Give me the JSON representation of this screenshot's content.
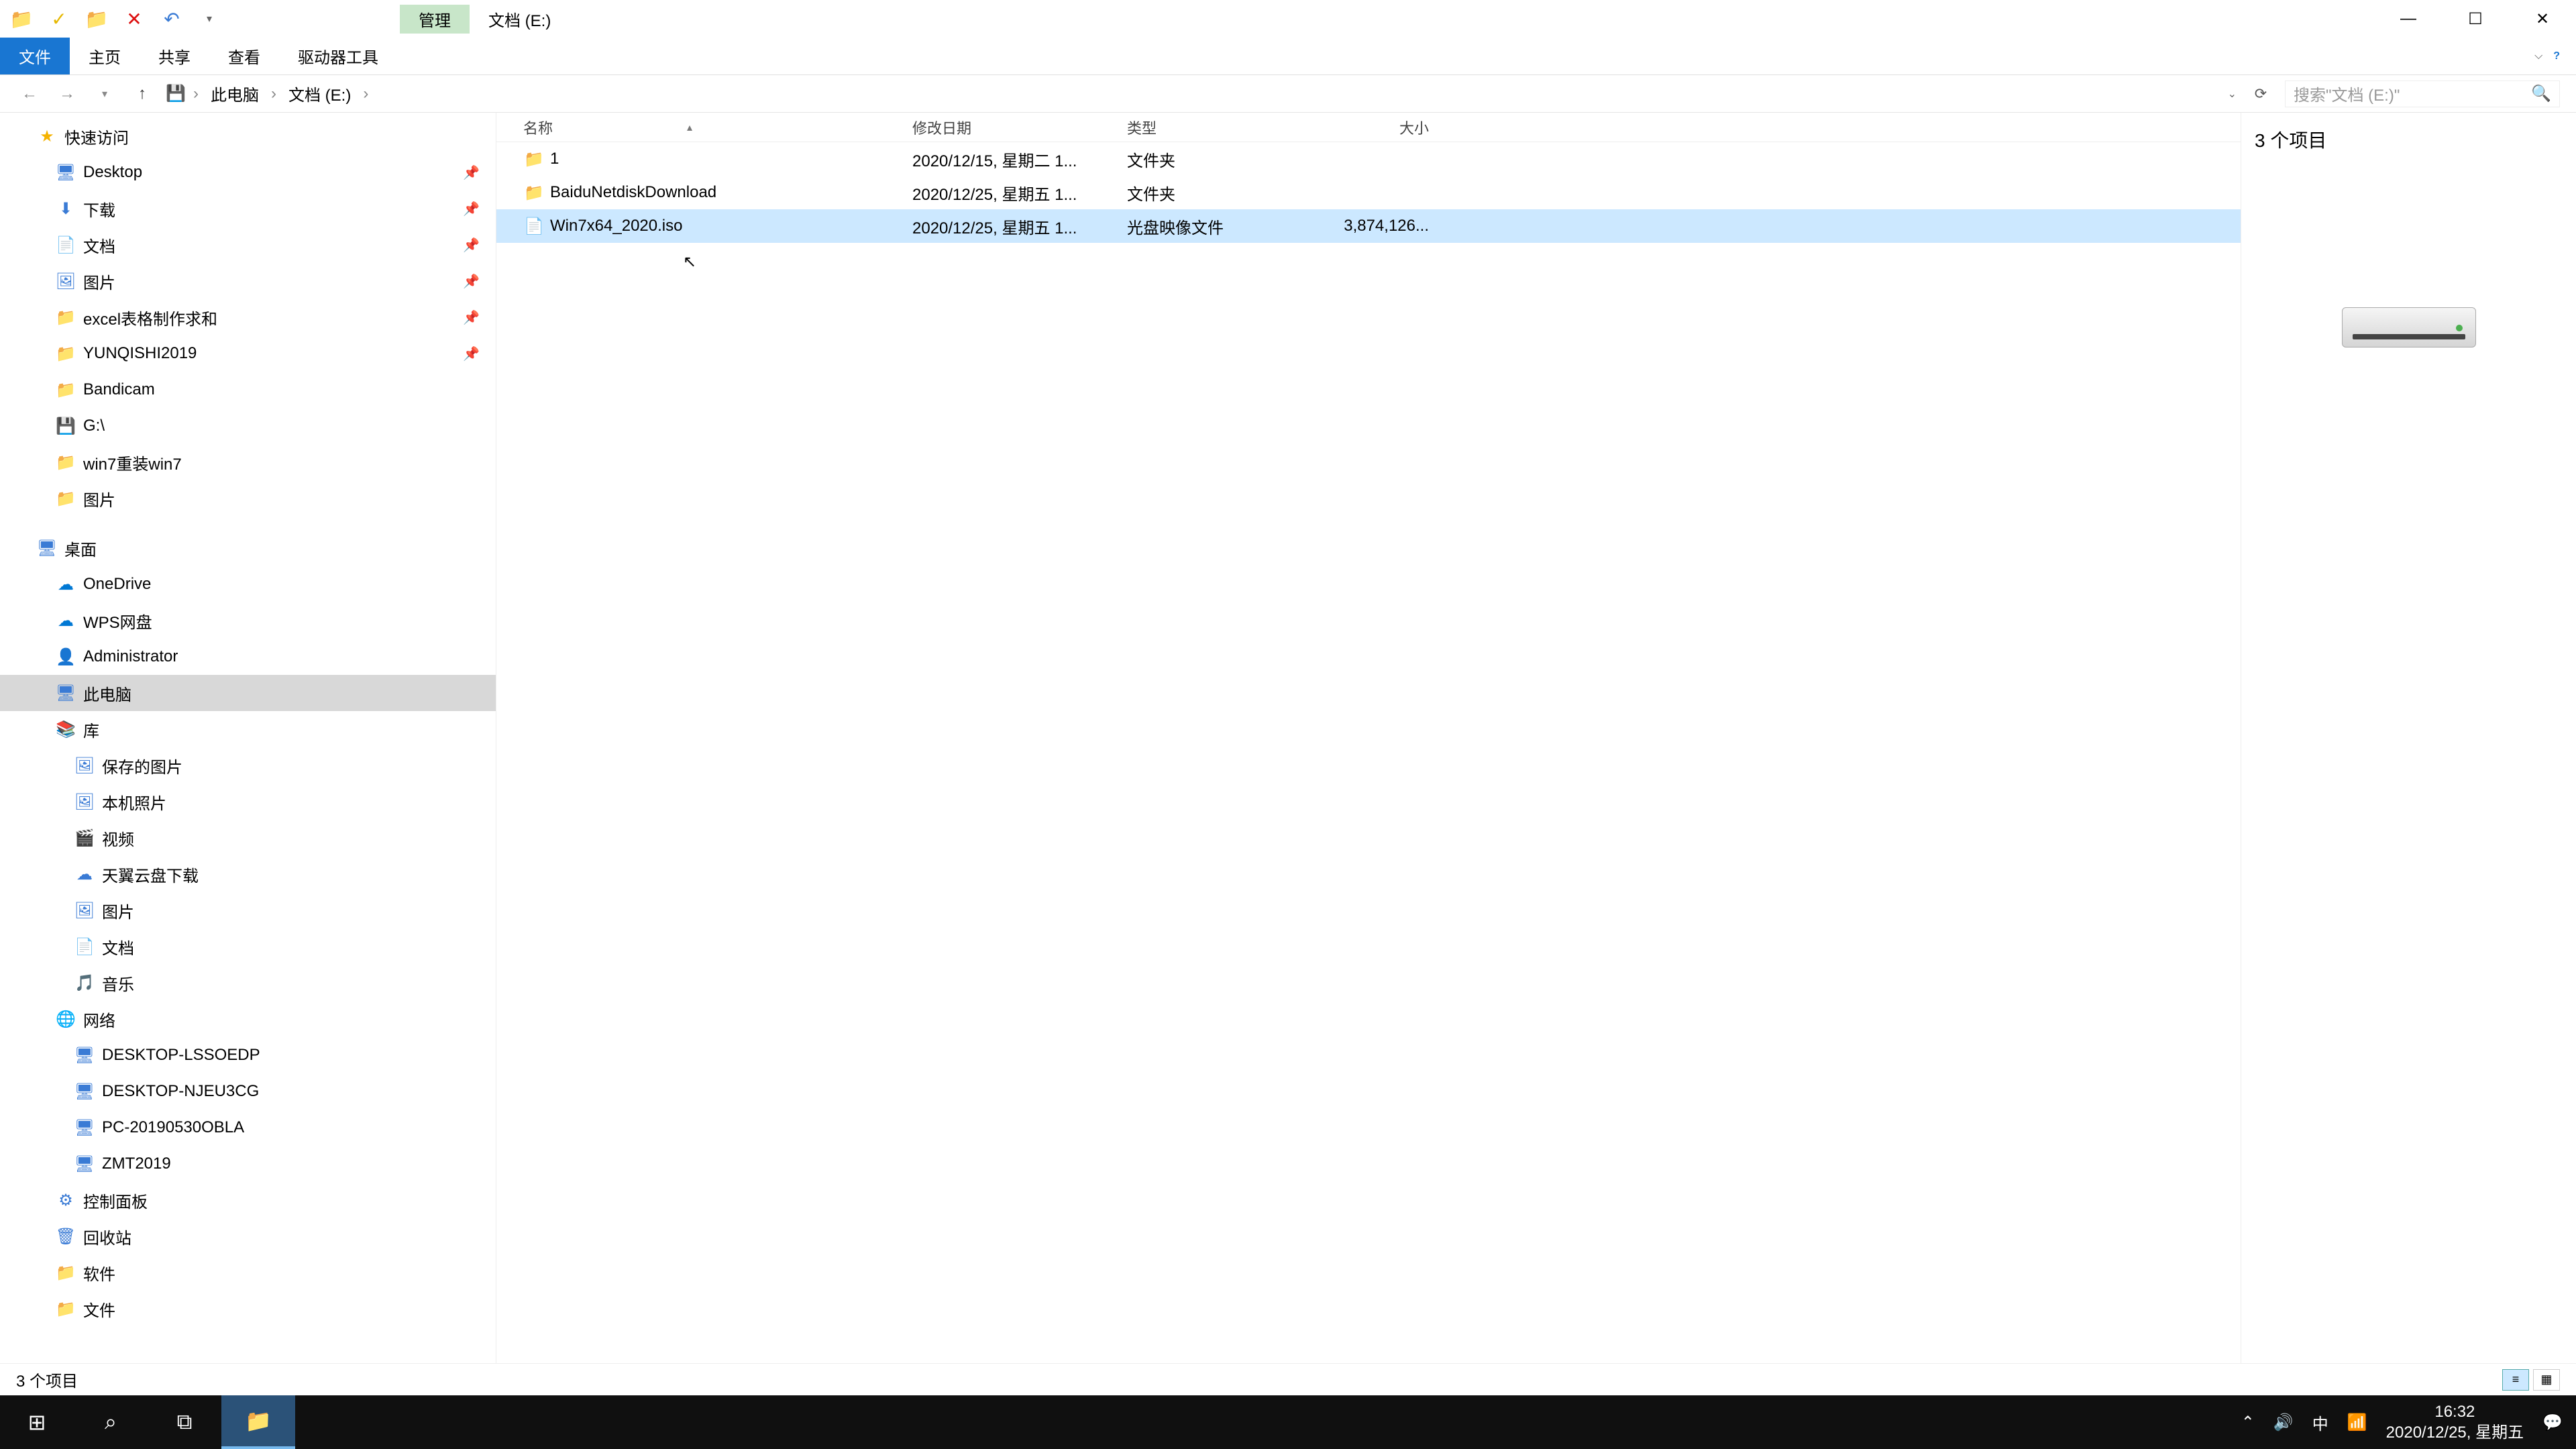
{
  "title": {
    "manage": "管理",
    "location": "文档 (E:)"
  },
  "ribbon": {
    "file": "文件",
    "home": "主页",
    "share": "共享",
    "view": "查看",
    "drive": "驱动器工具"
  },
  "addr": {
    "crumb1": "此电脑",
    "crumb2": "文档 (E:)"
  },
  "search": {
    "placeholder": "搜索\"文档 (E:)\""
  },
  "cols": {
    "name": "名称",
    "date": "修改日期",
    "type": "类型",
    "size": "大小"
  },
  "files": [
    {
      "icon": "📁",
      "name": "1",
      "date": "2020/12/15, 星期二 1...",
      "type": "文件夹",
      "size": ""
    },
    {
      "icon": "📁",
      "name": "BaiduNetdiskDownload",
      "date": "2020/12/25, 星期五 1...",
      "type": "文件夹",
      "size": ""
    },
    {
      "icon": "📄",
      "name": "Win7x64_2020.iso",
      "date": "2020/12/25, 星期五 1...",
      "type": "光盘映像文件",
      "size": "3,874,126..."
    }
  ],
  "nav": {
    "quick": "快速访问",
    "q": [
      "Desktop",
      "下载",
      "文档",
      "图片",
      "excel表格制作求和",
      "YUNQISHI2019",
      "Bandicam",
      "G:\\",
      "win7重装win7",
      "图片"
    ],
    "desktop": "桌面",
    "d": [
      "OneDrive",
      "WPS网盘",
      "Administrator",
      "此电脑",
      "库"
    ],
    "lib": [
      "保存的图片",
      "本机照片",
      "视频",
      "天翼云盘下载",
      "图片",
      "文档",
      "音乐"
    ],
    "net": "网络",
    "n": [
      "DESKTOP-LSSOEDP",
      "DESKTOP-NJEU3CG",
      "PC-20190530OBLA",
      "ZMT2019"
    ],
    "cp": "控制面板",
    "rb": "回收站",
    "sw": "软件",
    "docs": "文件"
  },
  "preview": {
    "count": "3 个项目"
  },
  "status": {
    "text": "3 个项目"
  },
  "tray": {
    "ime": "中",
    "time": "16:32",
    "date": "2020/12/25, 星期五"
  }
}
